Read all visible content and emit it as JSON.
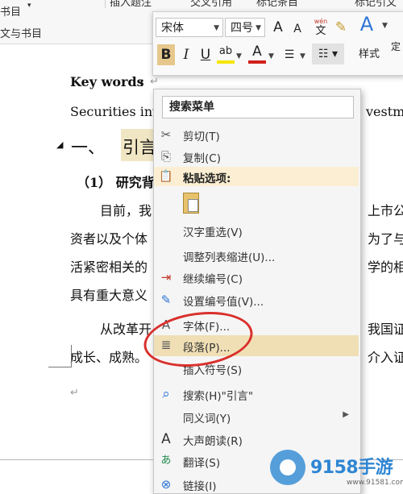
{
  "ribbon": {
    "bookmark_label": "书目",
    "bookmark_sub": "文与书目",
    "insert_caption": "插入题注",
    "cross_ref": "交叉引用",
    "mark_entry": "标记条目",
    "mark_citation": "标记引文"
  },
  "mini_toolbar": {
    "font_name": "宋体",
    "font_size": "四号",
    "grow_font": "A",
    "shrink_font": "A",
    "wen_label": "wén",
    "wen_char": "文",
    "bold": "B",
    "italic": "I",
    "underline": "U",
    "highlight": "ab",
    "font_color": "A",
    "style_label": "样式",
    "locate_label": "定",
    "accent_colors": {
      "highlight": "#f5e600",
      "font_color": "#d0201c",
      "text_effect": "#2e75d6"
    }
  },
  "document": {
    "keywords_label": "Key words",
    "keywords_colon": ":",
    "body_line1_left": "Securities inv",
    "body_line1_right": "vestme",
    "heading_num": "一、",
    "heading_text": "引言",
    "subheading": "（1）  研究背",
    "p1_a": "目前，我",
    "p1_a_right": "上市公",
    "p1_b": "资者以及个体",
    "p1_b_right": "为了与",
    "p1_c": "活紧密相关的",
    "p1_c_right": "学的相",
    "p1_d": "具有重大意义",
    "p2_a": "从改革开",
    "p2_a_right": "我国证",
    "p2_b": "成长、成熟。",
    "p2_b_right": "介入证",
    "pilcrow": "↵"
  },
  "context_menu": {
    "search_label": "搜索菜单",
    "items": [
      {
        "label": "剪切(T)",
        "icon": "scissors-icon",
        "glyph": "✂"
      },
      {
        "label": "复制(C)",
        "icon": "copy-icon",
        "glyph": "⎘"
      },
      {
        "label": "粘贴选项:",
        "icon": "paste-icon",
        "glyph": "📋"
      },
      {
        "label": "汉字重选(V)",
        "icon": "",
        "glyph": ""
      },
      {
        "label": "调整列表缩进(U)...",
        "icon": "",
        "glyph": ""
      },
      {
        "label": "继续编号(C)",
        "icon": "continue-numbering-icon",
        "glyph": "⇥"
      },
      {
        "label": "设置编号值(V)...",
        "icon": "set-numbering-value-icon",
        "glyph": "✎"
      },
      {
        "label": "字体(F)...",
        "icon": "font-icon",
        "glyph": "A"
      },
      {
        "label": "段落(P)...",
        "icon": "paragraph-icon",
        "glyph": "≣"
      },
      {
        "label": "插入符号(S)",
        "icon": "",
        "glyph": ""
      },
      {
        "label": "搜索(H)\"引言\"",
        "icon": "search-icon",
        "glyph": "⌕"
      },
      {
        "label": "同义词(Y)",
        "icon": "",
        "glyph": ""
      },
      {
        "label": "大声朗读(R)",
        "icon": "read-aloud-icon",
        "glyph": "A"
      },
      {
        "label": "翻译(S)",
        "icon": "translate-icon",
        "glyph": "あ"
      },
      {
        "label": "链接(I)",
        "icon": "link-icon",
        "glyph": "⊗"
      }
    ]
  },
  "watermark": {
    "brand": "9158手游",
    "url": "www.91581.com"
  },
  "colors": {
    "annotation_red": "#d9302c",
    "menu_highlight": "#f0dfb5",
    "heading_highlight": "#f1e6c4"
  }
}
